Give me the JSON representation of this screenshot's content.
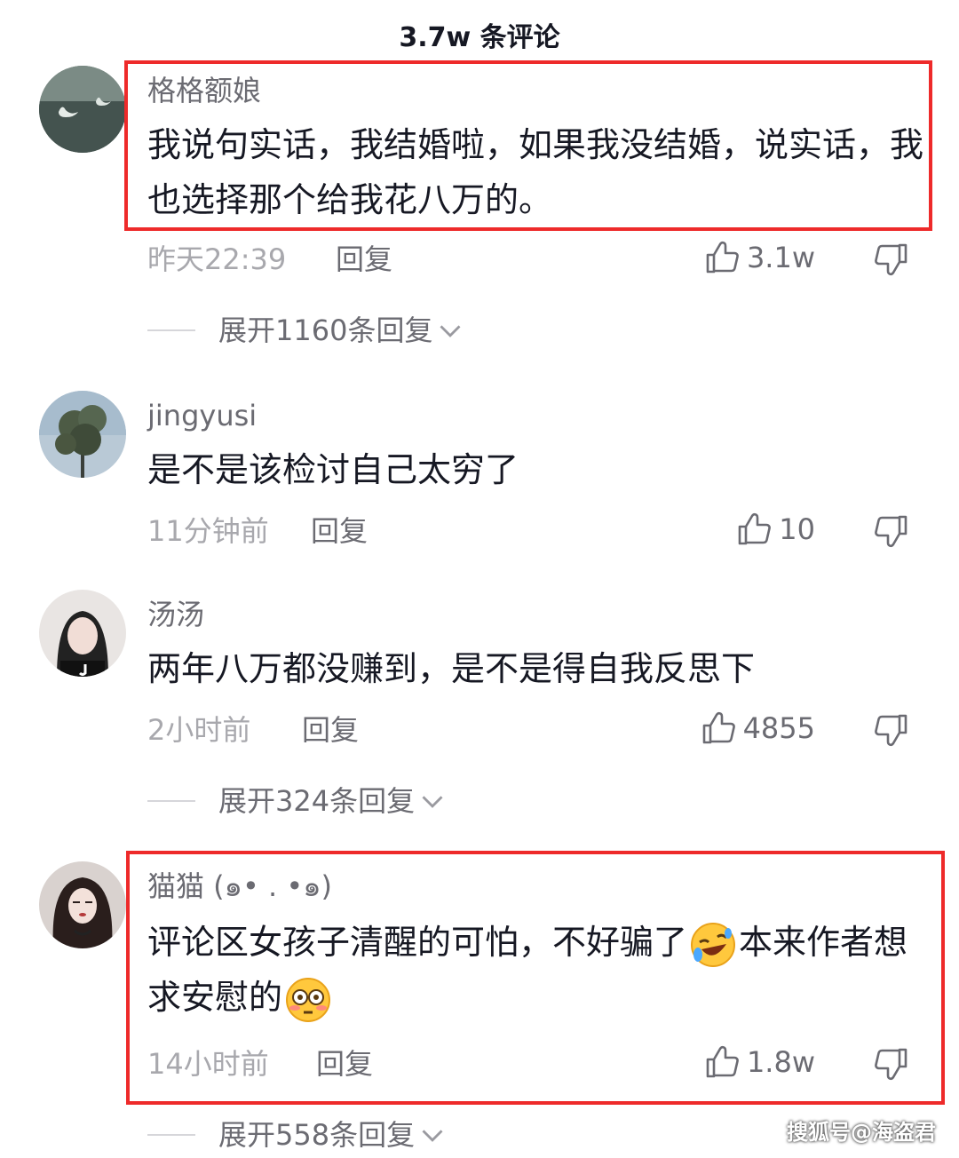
{
  "header": {
    "title": "3.7w 条评论"
  },
  "comments": [
    {
      "username": "格格额娘",
      "text": "我说句实话，我结婚啦，如果我没结婚，说实话，我也选择那个给我花八万的。",
      "time": "昨天22:39",
      "reply_label": "回复",
      "likes": "3.1w",
      "expand_label": "展开1160条回复"
    },
    {
      "username": "jingyusi",
      "text": "是不是该检讨自己太穷了",
      "time": "11分钟前",
      "reply_label": "回复",
      "likes": "10"
    },
    {
      "username": "汤汤",
      "text": "两年八万都没赚到，是不是得自我反思下",
      "time": "2小时前",
      "reply_label": "回复",
      "likes": "4855",
      "expand_label": "展开324条回复"
    },
    {
      "username": "猫猫 (๑• . •๑)",
      "text_part1": "评论区女孩子清醒的可怕，不好骗了",
      "text_part2": "本来作者想求安慰的",
      "emoji1": "rolling-laughing-emoji",
      "emoji2": "flushed-face-emoji",
      "time": "14小时前",
      "reply_label": "回复",
      "likes": "1.8w",
      "expand_label": "展开558条回复"
    }
  ],
  "watermark": "搜狐号@海盗君",
  "colors": {
    "highlight": "#ee2a2a",
    "text": "#161823",
    "secondary": "#6b6b72",
    "muted": "#a8a8ad"
  }
}
